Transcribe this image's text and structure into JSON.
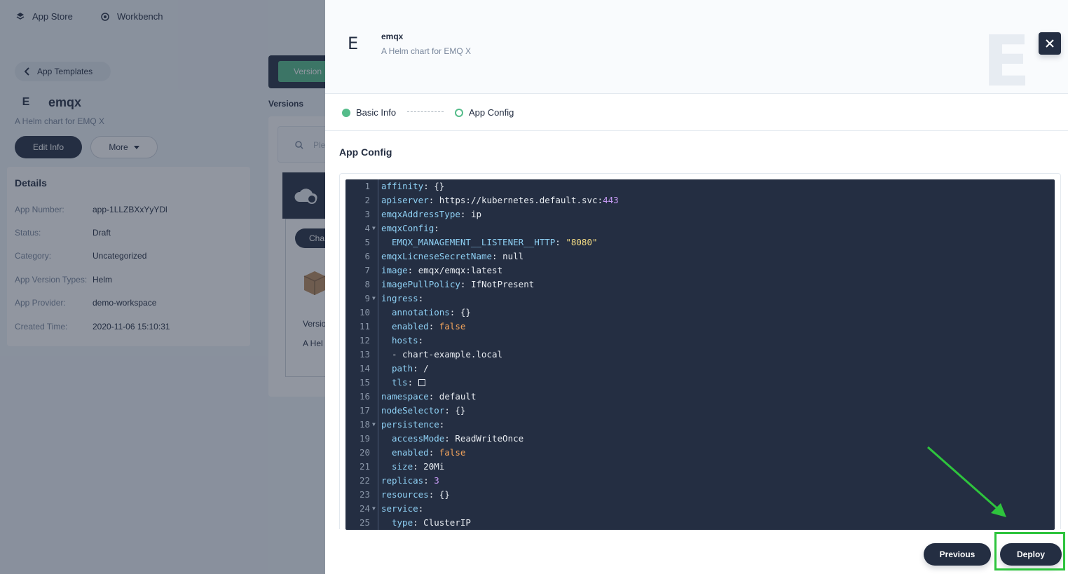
{
  "background": {
    "nav": {
      "app_store": "App Store",
      "workbench": "Workbench"
    },
    "back_link": "App Templates",
    "app": {
      "letter": "E",
      "name": "emqx",
      "description": "A Helm chart for EMQ X"
    },
    "edit_button": "Edit Info",
    "more_button": "More",
    "details": {
      "title": "Details",
      "rows": [
        {
          "key": "App Number:",
          "value": "app-1LLZBXxYyYDl"
        },
        {
          "key": "Status:",
          "value": "Draft"
        },
        {
          "key": "Category:",
          "value": "Uncategorized"
        },
        {
          "key": "App Version Types:",
          "value": "Helm"
        },
        {
          "key": "App Provider:",
          "value": "demo-workspace"
        },
        {
          "key": "Created Time:",
          "value": "2020-11-06 15:10:31"
        }
      ]
    },
    "versions_tab": "Version",
    "versions_label": "Versions",
    "search_placeholder": "Ple",
    "cha_button": "Cha",
    "version_text": "Versio",
    "version_desc": "A Hel"
  },
  "modal": {
    "letter": "E",
    "title": "emqx",
    "subtitle": "A Helm chart for EMQ X",
    "watermark": "E",
    "steps": [
      {
        "label": "Basic Info",
        "state": "done"
      },
      {
        "label": "App Config",
        "state": "current"
      }
    ],
    "section_title": "App Config",
    "code_lines": [
      {
        "n": "1",
        "fold": false,
        "indent": 0,
        "key": "affinity",
        "value": "{}",
        "type": "plain"
      },
      {
        "n": "2",
        "fold": false,
        "indent": 0,
        "key": "apiserver",
        "value": "https://kubernetes.default.svc:",
        "extra": "443",
        "type": "url"
      },
      {
        "n": "3",
        "fold": false,
        "indent": 0,
        "key": "emqxAddressType",
        "value": "ip",
        "type": "plain"
      },
      {
        "n": "4",
        "fold": true,
        "indent": 0,
        "key": "emqxConfig",
        "value": "",
        "type": "plain"
      },
      {
        "n": "5",
        "fold": false,
        "indent": 1,
        "key": "EMQX_MANAGEMENT__LISTENER__HTTP",
        "value": "\"8080\"",
        "type": "str"
      },
      {
        "n": "6",
        "fold": false,
        "indent": 0,
        "key": "emqxLicneseSecretName",
        "value": "null",
        "type": "plain"
      },
      {
        "n": "7",
        "fold": false,
        "indent": 0,
        "key": "image",
        "value": "emqx/emqx:latest",
        "type": "plain"
      },
      {
        "n": "8",
        "fold": false,
        "indent": 0,
        "key": "imagePullPolicy",
        "value": "IfNotPresent",
        "type": "plain"
      },
      {
        "n": "9",
        "fold": true,
        "indent": 0,
        "key": "ingress",
        "value": "",
        "type": "plain"
      },
      {
        "n": "10",
        "fold": false,
        "indent": 1,
        "key": "annotations",
        "value": "{}",
        "type": "plain"
      },
      {
        "n": "11",
        "fold": false,
        "indent": 1,
        "key": "enabled",
        "value": "false",
        "type": "bool"
      },
      {
        "n": "12",
        "fold": false,
        "indent": 1,
        "key": "hosts",
        "value": "",
        "type": "plain"
      },
      {
        "n": "13",
        "fold": false,
        "indent": 1,
        "key": "",
        "value": "- chart-example.local",
        "type": "list"
      },
      {
        "n": "14",
        "fold": false,
        "indent": 1,
        "key": "path",
        "value": "/",
        "type": "plain"
      },
      {
        "n": "15",
        "fold": false,
        "indent": 1,
        "key": "tls",
        "value": "",
        "type": "box"
      },
      {
        "n": "16",
        "fold": false,
        "indent": 0,
        "key": "namespace",
        "value": "default",
        "type": "plain"
      },
      {
        "n": "17",
        "fold": false,
        "indent": 0,
        "key": "nodeSelector",
        "value": "{}",
        "type": "plain"
      },
      {
        "n": "18",
        "fold": true,
        "indent": 0,
        "key": "persistence",
        "value": "",
        "type": "plain"
      },
      {
        "n": "19",
        "fold": false,
        "indent": 1,
        "key": "accessMode",
        "value": "ReadWriteOnce",
        "type": "plain"
      },
      {
        "n": "20",
        "fold": false,
        "indent": 1,
        "key": "enabled",
        "value": "false",
        "type": "bool"
      },
      {
        "n": "21",
        "fold": false,
        "indent": 1,
        "key": "size",
        "value": "20Mi",
        "type": "plain"
      },
      {
        "n": "22",
        "fold": false,
        "indent": 0,
        "key": "replicas",
        "value": "3",
        "type": "num"
      },
      {
        "n": "23",
        "fold": false,
        "indent": 0,
        "key": "resources",
        "value": "{}",
        "type": "plain"
      },
      {
        "n": "24",
        "fold": true,
        "indent": 0,
        "key": "service",
        "value": "",
        "type": "plain"
      },
      {
        "n": "25",
        "fold": false,
        "indent": 1,
        "key": "type",
        "value": "ClusterIP",
        "type": "plain"
      }
    ],
    "previous_button": "Previous",
    "deploy_button": "Deploy"
  },
  "colors": {
    "accent_green": "#55bc8a",
    "dark": "#242e42",
    "highlight": "#2ec43d"
  }
}
